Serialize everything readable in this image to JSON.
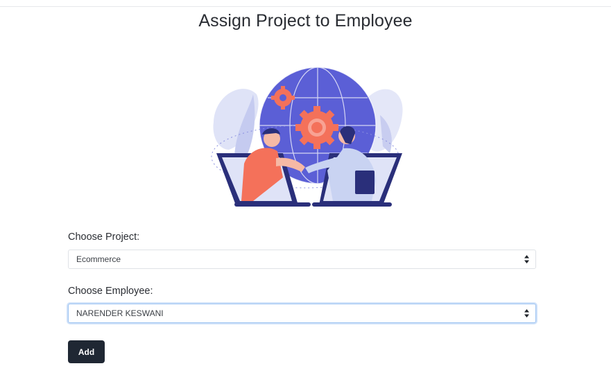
{
  "page": {
    "title": "Assign Project to Employee"
  },
  "illustration": {
    "icon": "handshake-globe-illustration",
    "colors": {
      "globe": "#5b5fd6",
      "gear": "#f4715a",
      "laptop": "#2a2f7a",
      "background_leaf": "#dfe3f7"
    }
  },
  "form": {
    "project": {
      "label": "Choose Project:",
      "selected": "Ecommerce"
    },
    "employee": {
      "label": "Choose Employee:",
      "selected": "NARENDER KESWANI"
    },
    "submit_label": "Add"
  },
  "colors": {
    "button_bg": "#1f2733",
    "focus_ring": "#9cc3f2"
  }
}
